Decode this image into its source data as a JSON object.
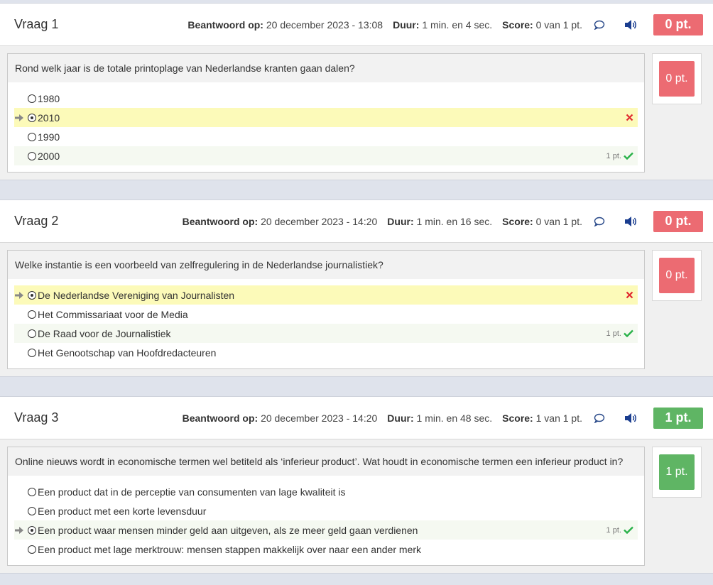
{
  "labels": {
    "answered_on": "Beantwoord op:",
    "duration": "Duur:",
    "score": "Score:"
  },
  "colors": {
    "wrong_badge": "#ec6b72",
    "correct_badge": "#5fb564",
    "wrong_row": "#fcfab9",
    "correct_row": "#f5f9f1"
  },
  "questions": [
    {
      "title": "Vraag 1",
      "answered_on": "20 december 2023 - 13:08",
      "duration": "1 min. en 4 sec.",
      "score": "0 van 1 pt.",
      "badge": "0 pt.",
      "prompt": "Rond welk jaar is de totale printoplage van Nederlandse kranten gaan dalen?",
      "options": [
        "1980",
        "2010",
        "1990",
        "2000"
      ],
      "points_label": "1 pt."
    },
    {
      "title": "Vraag 2",
      "answered_on": "20 december 2023 - 14:20",
      "duration": "1 min. en 16 sec.",
      "score": "0 van 1 pt.",
      "badge": "0 pt.",
      "prompt": "Welke instantie is een voorbeeld van zelfregulering in de Nederlandse journalistiek?",
      "options": [
        "De Nederlandse Vereniging van Journalisten",
        "Het Commissariaat voor de Media",
        "De Raad voor de Journalistiek",
        "Het Genootschap van Hoofdredacteuren"
      ],
      "points_label": "1 pt."
    },
    {
      "title": "Vraag 3",
      "answered_on": "20 december 2023 - 14:20",
      "duration": "1 min. en 48 sec.",
      "score": "1 van 1 pt.",
      "badge": "1 pt.",
      "prompt": "Online nieuws wordt in economische termen wel betiteld als ‘inferieur product’. Wat houdt in economische termen een inferieur product in?",
      "options": [
        "Een product dat in de perceptie van consumenten van lage kwaliteit is",
        "Een product met een korte levensduur",
        "Een product waar mensen minder geld aan uitgeven, als ze meer geld gaan verdienen",
        "Een product met lage merktrouw: mensen stappen makkelijk over naar een ander merk"
      ],
      "points_label": "1 pt."
    }
  ]
}
